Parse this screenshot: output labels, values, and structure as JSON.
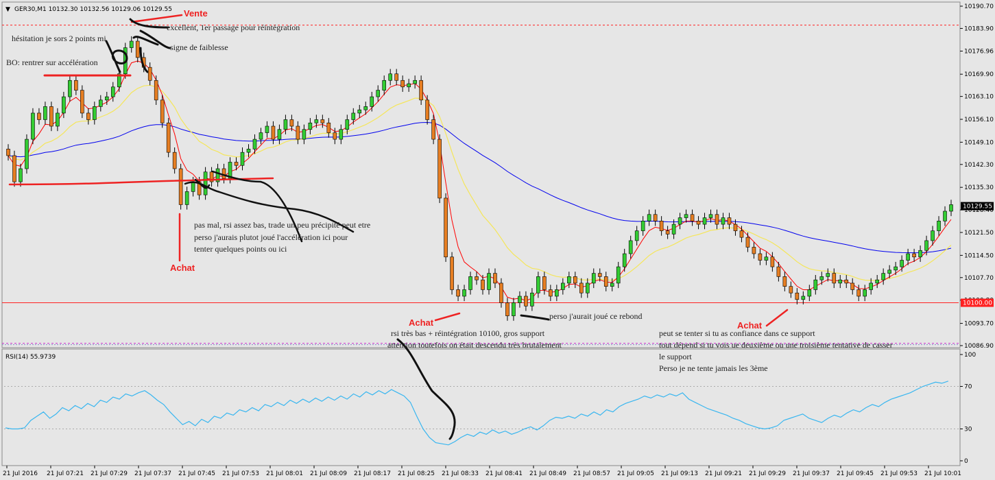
{
  "chart_data": [
    {
      "type": "candlestick",
      "symbol_header": "GER30,M1  10132.30 10132.56 10129.06 10129.55",
      "ylim": [
        10086.9,
        10190.7
      ],
      "price_ticks": [
        "10190.70",
        "10183.90",
        "10176.96",
        "10169.90",
        "10163.10",
        "10156.10",
        "10149.10",
        "10142.30",
        "10135.30",
        "10128.40",
        "10121.50",
        "10114.50",
        "10107.70",
        "10100.80",
        "10093.70",
        "10086.90"
      ],
      "current_price": "10129.55",
      "level_label": "10100.00",
      "level_value": 10100.0,
      "dotted_level": 10184.9,
      "bottom_dotted_level": 10087.6,
      "support_line_value": 10136.3,
      "resistance_line_value": 10169.3,
      "colors": {
        "up": "#33cc33",
        "down": "#e67e22",
        "fast_ma": "#ff0000",
        "mid_ma": "#f5e65a",
        "slow_ma": "#0000ee",
        "level": "#ff2020",
        "annot": "#ee2222"
      },
      "x_labels": [
        "21 Jul 2016",
        "21 Jul 07:21",
        "21 Jul 07:29",
        "21 Jul 07:37",
        "21 Jul 07:45",
        "21 Jul 07:53",
        "21 Jul 08:01",
        "21 Jul 08:09",
        "21 Jul 08:17",
        "21 Jul 08:25",
        "21 Jul 08:33",
        "21 Jul 08:41",
        "21 Jul 08:49",
        "21 Jul 08:57",
        "21 Jul 09:05",
        "21 Jul 09:13",
        "21 Jul 09:21",
        "21 Jul 09:29",
        "21 Jul 09:37",
        "21 Jul 09:45",
        "21 Jul 09:53",
        "21 Jul 10:01"
      ],
      "closes": [
        10145,
        10137,
        10141,
        10150,
        10158,
        10156,
        10160,
        10154,
        10158,
        10163,
        10168,
        10165,
        10158,
        10156,
        10160,
        10162,
        10163,
        10166,
        10170,
        10178,
        10180,
        10175,
        10172,
        10168,
        10162,
        10155,
        10146,
        10141,
        10130,
        10134,
        10137,
        10133,
        10140,
        10137,
        10141,
        10138,
        10143,
        10142,
        10146,
        10147,
        10150,
        10152,
        10154,
        10150,
        10153,
        10156,
        10154,
        10150,
        10153,
        10155,
        10156,
        10155,
        10152,
        10150,
        10153,
        10156,
        10158,
        10159,
        10160,
        10163,
        10165,
        10168,
        10170,
        10168,
        10166,
        10167,
        10168,
        10162,
        10156,
        10150,
        10132,
        10114,
        10104,
        10102,
        10104,
        10108,
        10107,
        10104,
        10109,
        10106,
        10100,
        10096,
        10100,
        10102,
        10099,
        10103,
        10108,
        10104,
        10102,
        10104,
        10106,
        10108,
        10106,
        10103,
        10106,
        10109,
        10108,
        10105,
        10106,
        10111,
        10115,
        10119,
        10122,
        10125,
        10127,
        10125,
        10122,
        10121,
        10124,
        10126,
        10127,
        10125,
        10124,
        10126,
        10127,
        10124,
        10126,
        10124,
        10122,
        10120,
        10117,
        10115,
        10113,
        10114,
        10111,
        10108,
        10105,
        10103,
        10101,
        10102,
        10104,
        10107,
        10108,
        10109,
        10106,
        10107,
        10106,
        10104,
        10102,
        10104,
        10106,
        10107,
        10109,
        10110,
        10111,
        10113,
        10115,
        10114,
        10116,
        10119,
        10122,
        10125,
        10128,
        10130
      ]
    },
    {
      "type": "line",
      "indicator_label": "RSI(14) 55.9739",
      "ylim": [
        0,
        100
      ],
      "y_ticks": [
        "100",
        "70",
        "30",
        "0"
      ],
      "levels": [
        70,
        30
      ],
      "values": [
        31,
        30,
        30,
        31,
        38,
        42,
        46,
        40,
        44,
        50,
        47,
        52,
        49,
        54,
        51,
        57,
        55,
        60,
        58,
        63,
        61,
        64,
        66,
        62,
        57,
        53,
        46,
        40,
        34,
        37,
        33,
        39,
        36,
        42,
        40,
        45,
        43,
        48,
        46,
        50,
        47,
        53,
        51,
        55,
        52,
        57,
        54,
        58,
        55,
        59,
        56,
        60,
        57,
        61,
        58,
        63,
        60,
        65,
        62,
        66,
        63,
        67,
        64,
        61,
        55,
        42,
        30,
        22,
        17,
        16,
        15,
        18,
        22,
        25,
        23,
        27,
        25,
        29,
        26,
        28,
        25,
        27,
        30,
        32,
        29,
        33,
        38,
        41,
        40,
        42,
        40,
        44,
        42,
        46,
        43,
        48,
        46,
        51,
        54,
        56,
        58,
        61,
        59,
        62,
        60,
        63,
        61,
        64,
        58,
        55,
        52,
        49,
        47,
        45,
        43,
        40,
        38,
        35,
        33,
        31,
        30,
        31,
        33,
        38,
        40,
        42,
        44,
        40,
        38,
        36,
        40,
        43,
        41,
        45,
        48,
        46,
        50,
        53,
        51,
        55,
        58,
        60,
        62,
        64,
        67,
        70,
        72,
        74,
        73,
        75
      ]
    }
  ],
  "annotations": {
    "vente": "Vente",
    "achat1": "Achat",
    "achat2": "Achat",
    "achat3": "Achat",
    "n_excellent": "excellent, 1er passage pour réintégration",
    "n_hesitation": "hésitation je sors 2 points mi",
    "n_faiblesse": "signe de faiblesse",
    "n_bo": "BO: rentrer sur accélération",
    "n_pasmal1": "pas mal, rsi assez bas, trade un peu précipité peut etre",
    "n_pasmal2": "perso j'aurais plutot joué l'accélération ici pour",
    "n_pasmal3": "tenter quelques points ou ici",
    "n_rebond": "perso j'aurait joué ce rebond",
    "n_rsi1": "rsi très bas + réintégration 10100, gros support",
    "n_rsi2": "attention toutefois on était descendu très brutalement",
    "n_conf1": "peut se tenter si tu as confiance dans ce support",
    "n_conf2": "tout dépend si tu vois ue deuxième ou une troisième tentative de casser",
    "n_conf3": "le support",
    "n_conf4": "Perso je ne tente jamais les 3ème"
  }
}
